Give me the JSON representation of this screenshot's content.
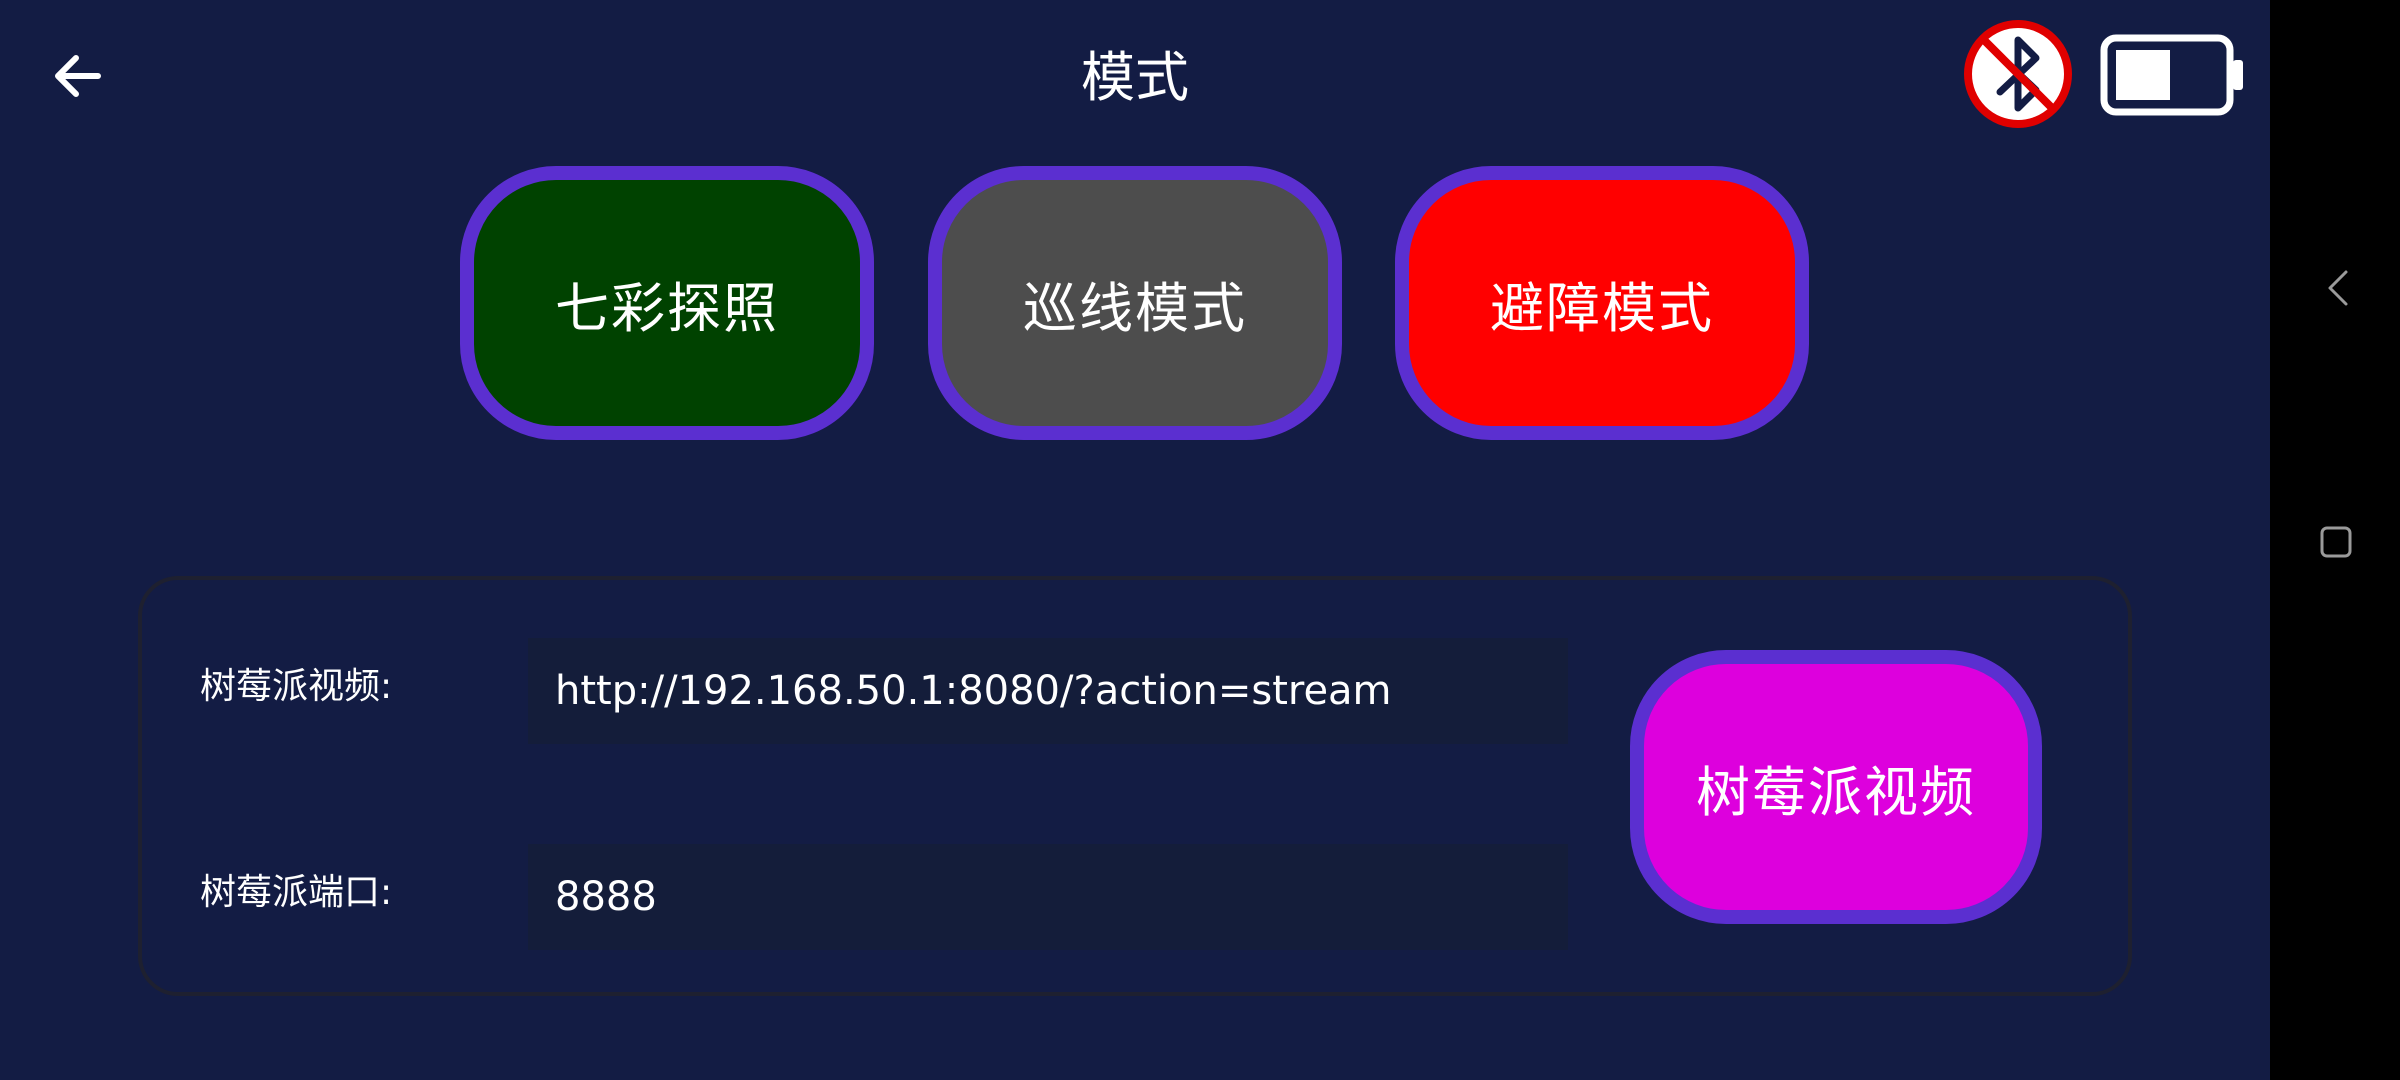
{
  "header": {
    "title": "模式",
    "back_icon": "arrow-left-icon",
    "bluetooth_icon": "bluetooth-disabled-icon",
    "battery_icon": "battery-half-icon"
  },
  "modes": [
    {
      "label": "七彩探照",
      "color": "#004200"
    },
    {
      "label": "巡线模式",
      "color": "#4d4d4d"
    },
    {
      "label": "避障模式",
      "color": "#ff0000"
    }
  ],
  "accent_border_color": "#5b2fd0",
  "form": {
    "video_label": "树莓派视频:",
    "video_value": "http://192.168.50.1:8080/?action=stream",
    "port_label": "树莓派端口:",
    "port_value": "8888",
    "video_button_label": "树莓派视频",
    "video_button_color": "#dd00dd"
  },
  "system_nav": {
    "back_icon": "chevron-left-icon",
    "home_icon": "square-icon"
  }
}
